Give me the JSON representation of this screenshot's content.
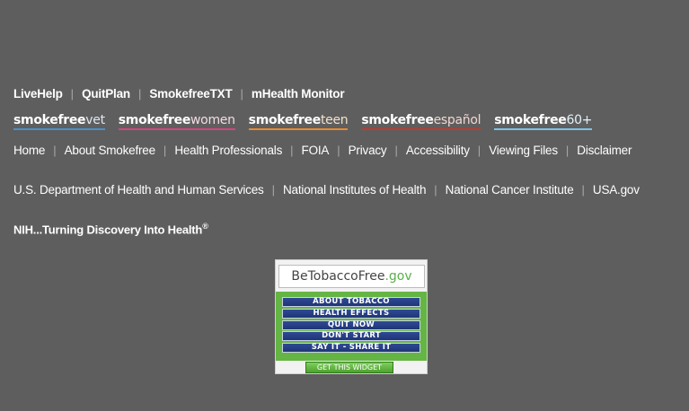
{
  "quit_links": [
    "LiveHelp",
    "QuitPlan",
    "SmokefreeTXT",
    "mHealth Monitor"
  ],
  "brands": {
    "prefix": "smokefree",
    "vet": "vet",
    "women": "women",
    "teen": "teen",
    "espanol": "español",
    "sixty": "60+"
  },
  "site_links": [
    "Home",
    "About Smokefree",
    "Health Professionals",
    "FOIA",
    "Privacy",
    "Accessibility",
    "Viewing Files",
    "Disclaimer"
  ],
  "gov_links": [
    "U.S. Department of Health and Human Services",
    "National Institutes of Health",
    "National Cancer Institute",
    "USA.gov"
  ],
  "nih_tagline": "NIH...Turning Discovery Into Health",
  "nih_mark": "®",
  "widget": {
    "logo_main": "BeTobaccoFree",
    "logo_gov": ".gov",
    "items": [
      "ABOUT TOBACCO",
      "HEALTH EFFECTS",
      "QUIT NOW",
      "DON'T START",
      "SAY IT - SHARE IT"
    ],
    "get_label": "GET THIS WIDGET"
  },
  "colors": {
    "background": "#5e5e5e",
    "vet": "#4a90c8",
    "women": "#d2467e",
    "teen": "#e88a2e",
    "espanol": "#c23a2f",
    "sixty": "#7ec2e6"
  }
}
